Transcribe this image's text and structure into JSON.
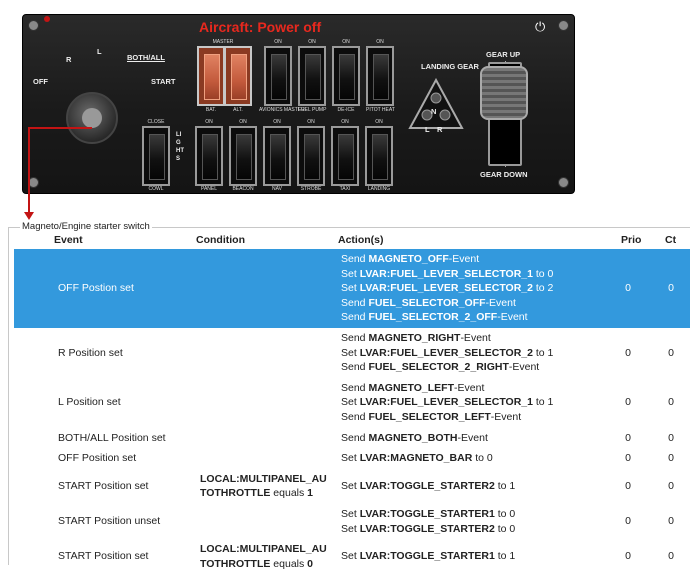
{
  "panel": {
    "overlay_title": "Aircraft: Power off",
    "magneto_labels": [
      "OFF",
      "R",
      "L",
      "BOTH/ALL",
      "START"
    ],
    "top_switches": [
      {
        "top": "MASTER",
        "bottom": "BAT."
      },
      {
        "top": "",
        "bottom": "ALT."
      },
      {
        "top": "ON",
        "bottom": "AVIONICS MASTER"
      },
      {
        "top": "ON",
        "bottom": "FUEL PUMP"
      },
      {
        "top": "ON",
        "bottom": "DE-ICE"
      },
      {
        "top": "ON",
        "bottom": "PITOT HEAT"
      }
    ],
    "cowl": {
      "top": "CLOSE",
      "bottom": "COWL"
    },
    "lights_label": "LIGHTS",
    "bottom_switches": [
      {
        "top": "ON",
        "bottom": "PANEL"
      },
      {
        "top": "ON",
        "bottom": "BEACON"
      },
      {
        "top": "ON",
        "bottom": "NAV"
      },
      {
        "top": "ON",
        "bottom": "STROBE"
      },
      {
        "top": "ON",
        "bottom": "TAXI"
      },
      {
        "top": "ON",
        "bottom": "LANDING"
      }
    ],
    "landing_gear_label": "LANDING GEAR",
    "gear_up": "GEAR UP",
    "gear_down": "GEAR DOWN",
    "tri_labels": [
      "N",
      "L",
      "R"
    ]
  },
  "group_label": "Magneto/Engine starter switch",
  "headers": {
    "event": "Event",
    "condition": "Condition",
    "actions": "Action(s)",
    "prio": "Prio",
    "ct": "Ct"
  },
  "rows": [
    {
      "event": "OFF Postion set",
      "selected": true,
      "cond": [],
      "actions": [
        {
          "pre": "Send ",
          "name": "MAGNETO_OFF",
          "post": "-Event"
        },
        {
          "pre": "Set ",
          "name": "LVAR:FUEL_LEVER_SELECTOR_1",
          "post": " to 0"
        },
        {
          "pre": "Set ",
          "name": "LVAR:FUEL_LEVER_SELECTOR_2",
          "post": " to 2"
        },
        {
          "pre": "Send ",
          "name": "FUEL_SELECTOR_OFF",
          "post": "-Event"
        },
        {
          "pre": "Send ",
          "name": "FUEL_SELECTOR_2_OFF",
          "post": "-Event"
        }
      ],
      "prio": "0",
      "ct": "0"
    },
    {
      "event": "R Position set",
      "cond": [],
      "actions": [
        {
          "pre": "Send ",
          "name": "MAGNETO_RIGHT",
          "post": "-Event"
        },
        {
          "pre": "Set ",
          "name": "LVAR:FUEL_LEVER_SELECTOR_2",
          "post": " to 1"
        },
        {
          "pre": "Send ",
          "name": "FUEL_SELECTOR_2_RIGHT",
          "post": "-Event"
        }
      ],
      "prio": "0",
      "ct": "0"
    },
    {
      "event": "L Position set",
      "cond": [],
      "actions": [
        {
          "pre": "Send ",
          "name": "MAGNETO_LEFT",
          "post": "-Event"
        },
        {
          "pre": "Set ",
          "name": "LVAR:FUEL_LEVER_SELECTOR_1",
          "post": " to 1"
        },
        {
          "pre": "Send ",
          "name": "FUEL_SELECTOR_LEFT",
          "post": "-Event"
        }
      ],
      "prio": "0",
      "ct": "0"
    },
    {
      "event": "BOTH/ALL Position set",
      "cond": [],
      "actions": [
        {
          "pre": "Send ",
          "name": "MAGNETO_BOTH",
          "post": "-Event"
        }
      ],
      "prio": "0",
      "ct": "0"
    },
    {
      "event": "OFF Position set",
      "cond": [],
      "actions": [
        {
          "pre": "Set ",
          "name": "LVAR:MAGNETO_BAR",
          "post": " to 0"
        }
      ],
      "prio": "0",
      "ct": "0"
    },
    {
      "event": "START Position set",
      "cond": [
        {
          "b": "LOCAL:MULTIPANEL_AU",
          "t": ""
        },
        {
          "b": "TOTHROTTLE",
          "t": " equals ",
          "v": "1"
        }
      ],
      "actions": [
        {
          "pre": "Set ",
          "name": "LVAR:TOGGLE_STARTER2",
          "post": " to 1"
        }
      ],
      "prio": "0",
      "ct": "0"
    },
    {
      "event": "START Position unset",
      "cond": [],
      "actions": [
        {
          "pre": "Set ",
          "name": "LVAR:TOGGLE_STARTER1",
          "post": " to 0"
        },
        {
          "pre": "Set ",
          "name": "LVAR:TOGGLE_STARTER2",
          "post": " to 0"
        }
      ],
      "prio": "0",
      "ct": "0"
    },
    {
      "event": "START Position set",
      "cond": [
        {
          "b": "LOCAL:MULTIPANEL_AU",
          "t": ""
        },
        {
          "b": "TOTHROTTLE",
          "t": " equals ",
          "v": "0"
        }
      ],
      "actions": [
        {
          "pre": "Set ",
          "name": "LVAR:TOGGLE_STARTER1",
          "post": " to 1"
        }
      ],
      "prio": "0",
      "ct": "0"
    }
  ],
  "colors": {
    "selection": "#3399dd",
    "arrow": "#c31414",
    "power_off": "#e8281e"
  }
}
